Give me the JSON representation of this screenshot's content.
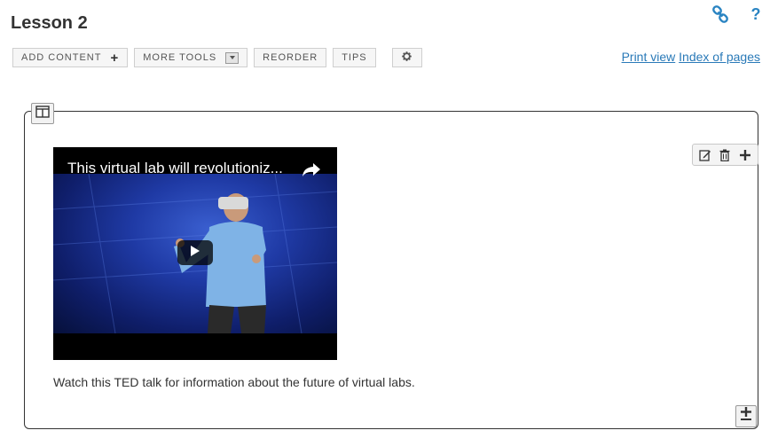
{
  "page": {
    "title": "Lesson 2"
  },
  "toolbar": {
    "add_content": "ADD CONTENT",
    "more_tools": "MORE TOOLS",
    "reorder": "REORDER",
    "tips": "TIPS"
  },
  "links": {
    "print_view": "Print view",
    "index_of_pages": "Index of pages"
  },
  "top_icons": [
    "link-icon",
    "help-icon"
  ],
  "help_glyph": "?",
  "video": {
    "title": "This virtual lab will revolutioniz..."
  },
  "caption": "Watch this TED talk for information about the future of virtual labs.",
  "colors": {
    "link": "#2a7ab8",
    "accent_icon": "#2a84c2",
    "video_bg": "#1f3aa5"
  }
}
